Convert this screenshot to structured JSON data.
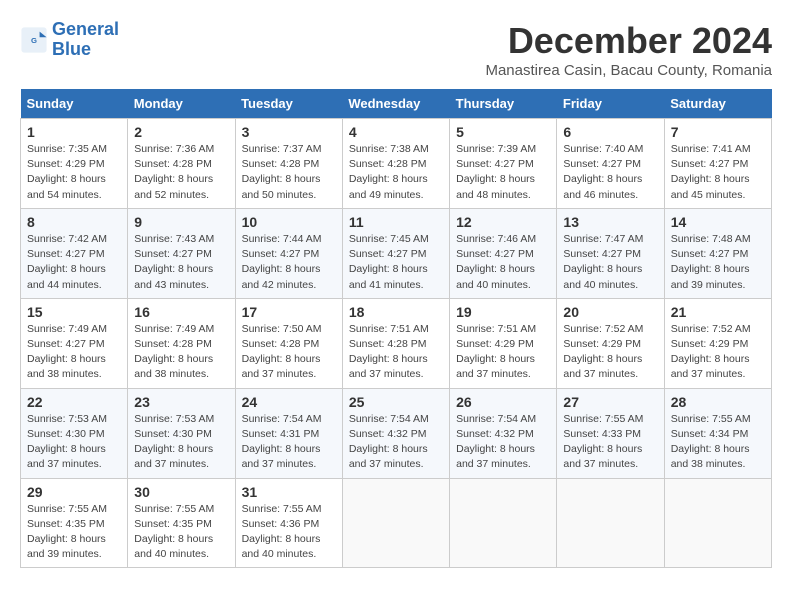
{
  "logo": {
    "line1": "General",
    "line2": "Blue"
  },
  "title": "December 2024",
  "subtitle": "Manastirea Casin, Bacau County, Romania",
  "days_of_week": [
    "Sunday",
    "Monday",
    "Tuesday",
    "Wednesday",
    "Thursday",
    "Friday",
    "Saturday"
  ],
  "weeks": [
    [
      {
        "day": "1",
        "sunrise": "7:35 AM",
        "sunset": "4:29 PM",
        "daylight": "8 hours and 54 minutes."
      },
      {
        "day": "2",
        "sunrise": "7:36 AM",
        "sunset": "4:28 PM",
        "daylight": "8 hours and 52 minutes."
      },
      {
        "day": "3",
        "sunrise": "7:37 AM",
        "sunset": "4:28 PM",
        "daylight": "8 hours and 50 minutes."
      },
      {
        "day": "4",
        "sunrise": "7:38 AM",
        "sunset": "4:28 PM",
        "daylight": "8 hours and 49 minutes."
      },
      {
        "day": "5",
        "sunrise": "7:39 AM",
        "sunset": "4:27 PM",
        "daylight": "8 hours and 48 minutes."
      },
      {
        "day": "6",
        "sunrise": "7:40 AM",
        "sunset": "4:27 PM",
        "daylight": "8 hours and 46 minutes."
      },
      {
        "day": "7",
        "sunrise": "7:41 AM",
        "sunset": "4:27 PM",
        "daylight": "8 hours and 45 minutes."
      }
    ],
    [
      {
        "day": "8",
        "sunrise": "7:42 AM",
        "sunset": "4:27 PM",
        "daylight": "8 hours and 44 minutes."
      },
      {
        "day": "9",
        "sunrise": "7:43 AM",
        "sunset": "4:27 PM",
        "daylight": "8 hours and 43 minutes."
      },
      {
        "day": "10",
        "sunrise": "7:44 AM",
        "sunset": "4:27 PM",
        "daylight": "8 hours and 42 minutes."
      },
      {
        "day": "11",
        "sunrise": "7:45 AM",
        "sunset": "4:27 PM",
        "daylight": "8 hours and 41 minutes."
      },
      {
        "day": "12",
        "sunrise": "7:46 AM",
        "sunset": "4:27 PM",
        "daylight": "8 hours and 40 minutes."
      },
      {
        "day": "13",
        "sunrise": "7:47 AM",
        "sunset": "4:27 PM",
        "daylight": "8 hours and 40 minutes."
      },
      {
        "day": "14",
        "sunrise": "7:48 AM",
        "sunset": "4:27 PM",
        "daylight": "8 hours and 39 minutes."
      }
    ],
    [
      {
        "day": "15",
        "sunrise": "7:49 AM",
        "sunset": "4:27 PM",
        "daylight": "8 hours and 38 minutes."
      },
      {
        "day": "16",
        "sunrise": "7:49 AM",
        "sunset": "4:28 PM",
        "daylight": "8 hours and 38 minutes."
      },
      {
        "day": "17",
        "sunrise": "7:50 AM",
        "sunset": "4:28 PM",
        "daylight": "8 hours and 37 minutes."
      },
      {
        "day": "18",
        "sunrise": "7:51 AM",
        "sunset": "4:28 PM",
        "daylight": "8 hours and 37 minutes."
      },
      {
        "day": "19",
        "sunrise": "7:51 AM",
        "sunset": "4:29 PM",
        "daylight": "8 hours and 37 minutes."
      },
      {
        "day": "20",
        "sunrise": "7:52 AM",
        "sunset": "4:29 PM",
        "daylight": "8 hours and 37 minutes."
      },
      {
        "day": "21",
        "sunrise": "7:52 AM",
        "sunset": "4:29 PM",
        "daylight": "8 hours and 37 minutes."
      }
    ],
    [
      {
        "day": "22",
        "sunrise": "7:53 AM",
        "sunset": "4:30 PM",
        "daylight": "8 hours and 37 minutes."
      },
      {
        "day": "23",
        "sunrise": "7:53 AM",
        "sunset": "4:30 PM",
        "daylight": "8 hours and 37 minutes."
      },
      {
        "day": "24",
        "sunrise": "7:54 AM",
        "sunset": "4:31 PM",
        "daylight": "8 hours and 37 minutes."
      },
      {
        "day": "25",
        "sunrise": "7:54 AM",
        "sunset": "4:32 PM",
        "daylight": "8 hours and 37 minutes."
      },
      {
        "day": "26",
        "sunrise": "7:54 AM",
        "sunset": "4:32 PM",
        "daylight": "8 hours and 37 minutes."
      },
      {
        "day": "27",
        "sunrise": "7:55 AM",
        "sunset": "4:33 PM",
        "daylight": "8 hours and 37 minutes."
      },
      {
        "day": "28",
        "sunrise": "7:55 AM",
        "sunset": "4:34 PM",
        "daylight": "8 hours and 38 minutes."
      }
    ],
    [
      {
        "day": "29",
        "sunrise": "7:55 AM",
        "sunset": "4:35 PM",
        "daylight": "8 hours and 39 minutes."
      },
      {
        "day": "30",
        "sunrise": "7:55 AM",
        "sunset": "4:35 PM",
        "daylight": "8 hours and 40 minutes."
      },
      {
        "day": "31",
        "sunrise": "7:55 AM",
        "sunset": "4:36 PM",
        "daylight": "8 hours and 40 minutes."
      },
      null,
      null,
      null,
      null
    ]
  ]
}
